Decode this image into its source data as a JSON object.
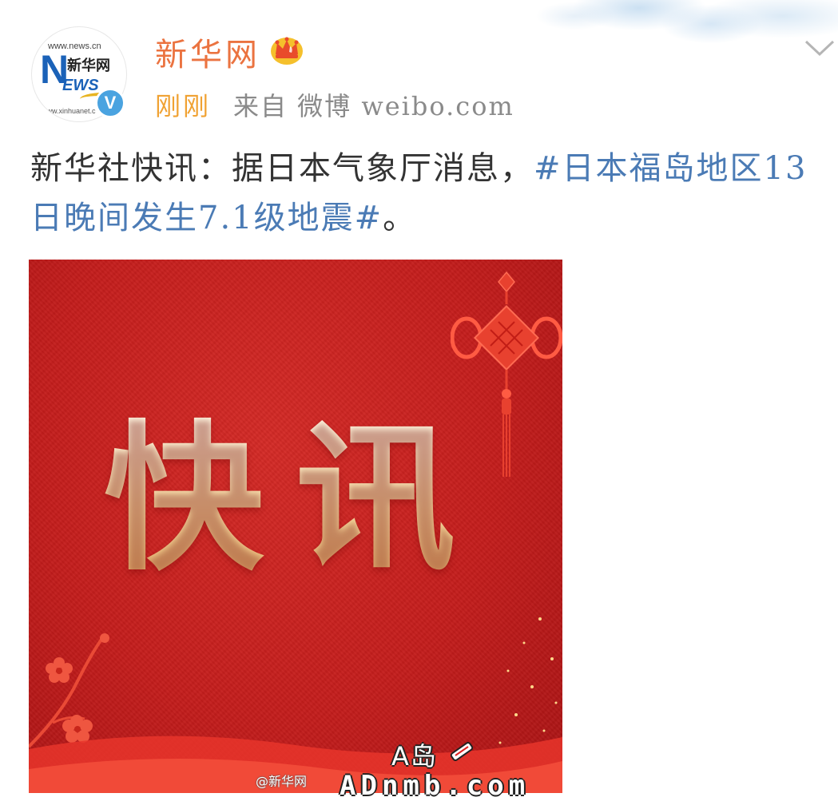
{
  "post": {
    "author": {
      "name": "新华网",
      "avatar_text": {
        "url_top": "www.news.cn",
        "logo_n": "N",
        "logo_news": "EWS",
        "logo_cn": "新华网",
        "url_bottom": "www.xinhuanet.c"
      },
      "verified_mark": "V"
    },
    "meta": {
      "time": "刚刚",
      "source": "来自 微博 weibo.com"
    },
    "text": {
      "prefix": "新华社快讯：据日本气象厅消息，",
      "topic": "#日本福岛地区13日晚间发生7.1级地震#",
      "suffix": "。"
    },
    "image": {
      "headline": "快讯",
      "watermark_weibo": "@新华网",
      "watermark_a_dao": "A岛",
      "watermark_site": "ADnmb.com"
    }
  },
  "colors": {
    "username": "#eb7340",
    "time": "#f0a233",
    "topic": "#4b7bb5",
    "verified": "#4aa3e0",
    "image_red": "#c41d1c"
  },
  "icons": {
    "vip": "crown-icon",
    "expand": "chevron-down-icon",
    "verified": "verified-badge-icon"
  }
}
